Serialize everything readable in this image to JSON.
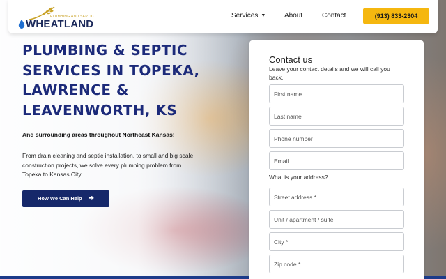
{
  "logo": {
    "small_text": "PLUMBING AND SEPTIC",
    "main_text": "WHEATLAND"
  },
  "nav": {
    "services": "Services",
    "about": "About",
    "contact": "Contact",
    "phone": "(913) 833-2304"
  },
  "hero": {
    "title": "PLUMBING & SEPTIC SERVICES IN TOPEKA, LAWRENCE & LEAVENWORTH, KS",
    "subtitle": "And surrounding areas throughout Northeast Kansas!",
    "description": "From drain cleaning and septic installation, to small and big scale construction projects, we solve every plumbing problem from Topeka to Kansas City.",
    "cta_label": "How We Can Help"
  },
  "contact_form": {
    "title": "Contact us",
    "intro": "Leave your contact details and we will call you back.",
    "address_label": "What is your address?",
    "fields": {
      "first_name": "First name",
      "last_name": "Last name",
      "phone": "Phone number",
      "email": "Email",
      "street": "Street address *",
      "unit": "Unit / apartment / suite",
      "city": "City *",
      "zip": "Zip code *"
    }
  },
  "colors": {
    "brand_navy": "#1c2a7a",
    "button_navy": "#16286a",
    "accent_yellow": "#f5b70f",
    "logo_gold": "#c9a227"
  },
  "icons": [
    "wheat-icon",
    "water-drop-icon",
    "chevron-down-icon",
    "arrow-right-icon"
  ]
}
